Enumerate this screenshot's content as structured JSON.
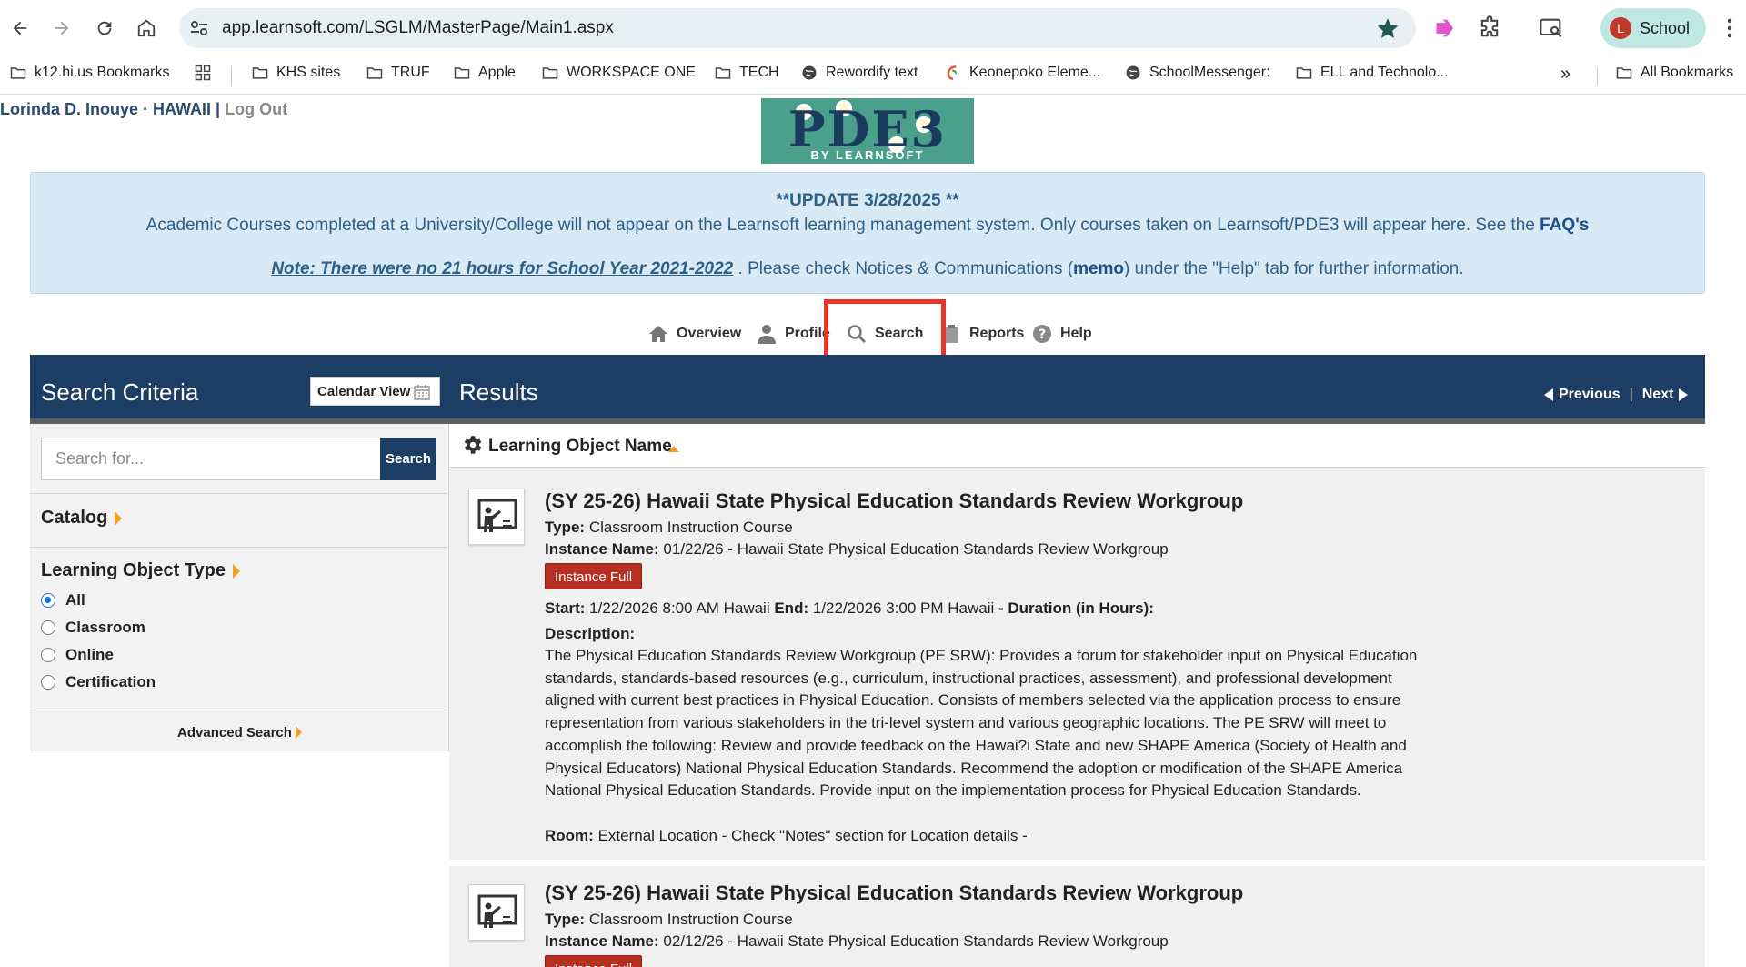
{
  "browser": {
    "url": "app.learnsoft.com/LSGLM/MasterPage/Main1.aspx",
    "profile_initial": "L",
    "profile_name": "School",
    "bookmarks": [
      {
        "label": "k12.hi.us Bookmarks",
        "icon": "folder-icon"
      },
      {
        "label": "KHS sites",
        "icon": "folder-icon"
      },
      {
        "label": "TRUF",
        "icon": "folder-icon"
      },
      {
        "label": "Apple",
        "icon": "folder-icon"
      },
      {
        "label": "WORKSPACE ONE",
        "icon": "folder-icon"
      },
      {
        "label": "TECH",
        "icon": "folder-icon"
      },
      {
        "label": "Rewordify text",
        "icon": "globe-icon"
      },
      {
        "label": "Keonepoko Eleme...",
        "icon": "site-icon"
      },
      {
        "label": "SchoolMessenger:",
        "icon": "globe-icon"
      },
      {
        "label": "ELL and Technolo...",
        "icon": "folder-icon"
      },
      {
        "label": "All Bookmarks",
        "icon": "folder-icon"
      }
    ],
    "overflow": "»"
  },
  "user": {
    "name": "Lorinda D. Inouye · HAWAII",
    "separator": "|",
    "logout": "Log Out"
  },
  "logo": {
    "text": "PDE3",
    "byline": "BY LEARNSOFT"
  },
  "notice": {
    "update": "**UPDATE 3/28/2025 **",
    "line2": "Academic Courses completed at a University/College will not appear on the Learnsoft learning management system.  Only courses taken on Learnsoft/PDE3 will appear here.  See the ",
    "faq": "FAQ's",
    "note": "Note:  There were no 21 hours for School Year 2021-2022",
    "line3": " . Please check Notices & Communications (",
    "memo": "memo",
    "line3_end": ") under the \"Help\" tab for further information."
  },
  "tabs": [
    {
      "label": "Overview",
      "icon": "home-icon"
    },
    {
      "label": "Profile",
      "icon": "person-icon"
    },
    {
      "label": "Search",
      "icon": "search-icon"
    },
    {
      "label": "Reports",
      "icon": "clipboard-icon"
    },
    {
      "label": "Help",
      "icon": "help-icon"
    }
  ],
  "header": {
    "criteria_title": "Search Criteria",
    "calendar_view": "Calendar View",
    "results_title": "Results",
    "previous": "Previous",
    "separator": "|",
    "next": "Next"
  },
  "left_panel": {
    "search_placeholder": "Search for...",
    "search_button": "Search",
    "catalog": "Catalog",
    "lo_type": "Learning Object Type",
    "types": [
      {
        "label": "All",
        "checked": true
      },
      {
        "label": "Classroom",
        "checked": false
      },
      {
        "label": "Online",
        "checked": false
      },
      {
        "label": "Certification",
        "checked": false
      }
    ],
    "advanced": "Advanced Search"
  },
  "results": {
    "sort_label": "Learning Object Name",
    "items": [
      {
        "title": "(SY 25-26) Hawaii State Physical Education Standards Review Workgroup",
        "type_label": "Type:",
        "type": "Classroom Instruction Course",
        "instance_label": "Instance Name:",
        "instance": "01/22/26 - Hawaii State Physical Education Standards Review Workgroup",
        "status": "Instance Full",
        "start_label": "Start:",
        "start": "1/22/2026 8:00 AM Hawaii",
        "end_label": "End:",
        "end": "1/22/2026 3:00 PM Hawaii",
        "duration_label": "- Duration (in Hours):",
        "description_label": "Description:",
        "description": "The Physical Education Standards Review Workgroup (PE SRW): Provides a forum for stakeholder input on Physical Education standards, standards-based resources (e.g., curriculum, instructional practices, assessment), and professional development aligned with current best practices in Physical Education. Consists of members selected via the application process to ensure representation from various stakeholders in the tri-level system and various geographic locations. The PE SRW will meet to accomplish the following: Review and provide feedback on the Hawai?i State and new SHAPE America (Society of Health and Physical Educators) National Physical Education Standards. Recommend the adoption or modification of the SHAPE America National Physical Education Standards. Provide input on the implementation process for Physical Education Standards.",
        "room_label": "Room:",
        "room": "External Location - Check \"Notes\" section for Location details -"
      },
      {
        "title": "(SY 25-26) Hawaii State Physical Education Standards Review Workgroup",
        "type_label": "Type:",
        "type": "Classroom Instruction Course",
        "instance_label": "Instance Name:",
        "instance": "02/12/26 - Hawaii State Physical Education Standards Review Workgroup",
        "status": "Instance Full"
      }
    ]
  },
  "colors": {
    "navy": "#1c3d64",
    "notice_bg": "#d8eaf6",
    "badge_red": "#b62f20",
    "highlight_red": "#e8352a",
    "accent_orange": "#f0a020"
  }
}
